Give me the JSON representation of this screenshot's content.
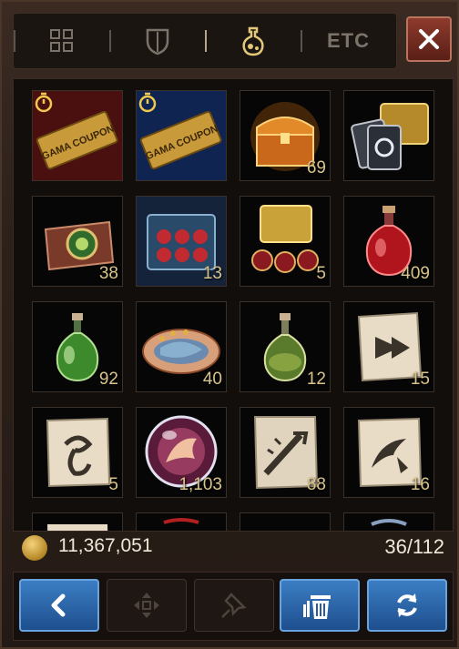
{
  "tabs": [
    {
      "name": "grid-icon",
      "label": ""
    },
    {
      "name": "shield-icon",
      "label": ""
    },
    {
      "name": "potion-icon",
      "label": ""
    },
    {
      "name": "etc",
      "label": "ETC"
    }
  ],
  "active_tab": 2,
  "items": [
    {
      "name": "gama-coupon-red",
      "qty": "",
      "coupon": "GAMA COUPON"
    },
    {
      "name": "gama-coupon-blue",
      "qty": "",
      "coupon": "GAMA COUPON"
    },
    {
      "name": "orange-treasure-chest",
      "qty": "69"
    },
    {
      "name": "chest-with-cards",
      "qty": ""
    },
    {
      "name": "emerald-emblem-chest",
      "qty": "38"
    },
    {
      "name": "potion-crate",
      "qty": "13"
    },
    {
      "name": "gold-chest-with-orbs",
      "qty": "5"
    },
    {
      "name": "red-potion",
      "qty": "409"
    },
    {
      "name": "green-potion",
      "qty": "92"
    },
    {
      "name": "fish-dish",
      "qty": "40"
    },
    {
      "name": "elixir-bottle",
      "qty": "12"
    },
    {
      "name": "scroll-arrow",
      "qty": "15"
    },
    {
      "name": "scroll-rune",
      "qty": "5"
    },
    {
      "name": "dragon-orb",
      "qty": "1,103"
    },
    {
      "name": "scroll-sword",
      "qty": "88"
    },
    {
      "name": "scroll-scythe",
      "qty": "16"
    }
  ],
  "footer": {
    "gold": "11,367,051",
    "capacity": "36/112"
  },
  "buttons": [
    {
      "name": "back-button",
      "icon": "chevron-left-icon",
      "style": "blue"
    },
    {
      "name": "move-button",
      "icon": "move-icon",
      "style": "dim"
    },
    {
      "name": "pin-button",
      "icon": "pin-icon",
      "style": "dim"
    },
    {
      "name": "discard-button",
      "icon": "trash-icon",
      "style": "blue"
    },
    {
      "name": "refresh-button",
      "icon": "refresh-icon",
      "style": "blue"
    }
  ]
}
